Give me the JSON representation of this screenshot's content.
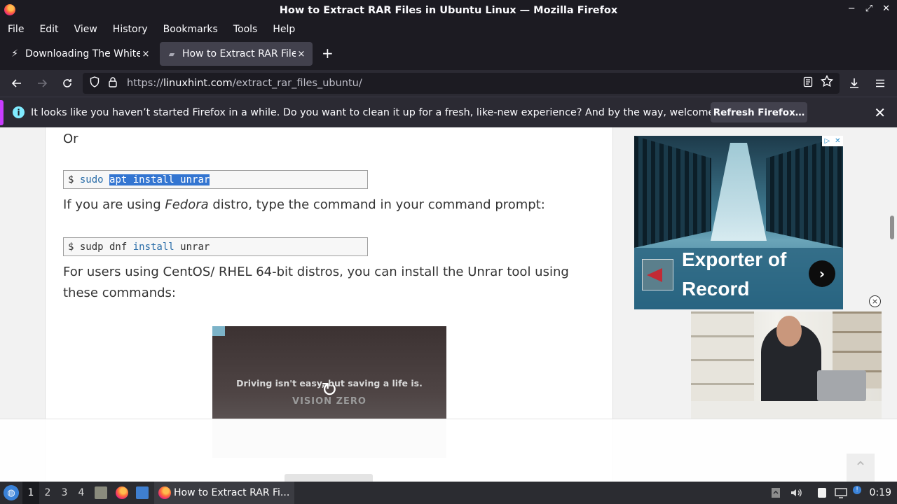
{
  "window": {
    "title": "How to Extract RAR Files in Ubuntu Linux — Mozilla Firefox",
    "controls": {
      "minimize": "−",
      "maximize": "⤢",
      "close": "✕"
    }
  },
  "menu": [
    "File",
    "Edit",
    "View",
    "History",
    "Bookmarks",
    "Tools",
    "Help"
  ],
  "tabs": [
    {
      "title": "Downloading The White Ho",
      "icon": "lightning-icon",
      "close": "×"
    },
    {
      "title": "How to Extract RAR Files i",
      "icon": "linuxhint-icon",
      "close": "×"
    }
  ],
  "new_tab": "+",
  "navbar": {
    "url_prefix": "https://",
    "url_domain": "linuxhint.com",
    "url_path": "/extract_rar_files_ubuntu/"
  },
  "notification": {
    "info_glyph": "i",
    "message": "It looks like you haven’t started Firefox in a while. Do you want to clean it up for a fresh, like-new experience? And by the way, welcome back!",
    "button": "Refresh Firefox…",
    "close": "✕"
  },
  "article": {
    "or_text": "Or",
    "code1": {
      "prompt": "$ ",
      "cmd": "sudo",
      "selected": "apt install unrar"
    },
    "fedora_pre": "If you are using ",
    "fedora_em": "Fedora",
    "fedora_post": " distro, type the command in your command prompt:",
    "code2": {
      "prompt": "$ ",
      "cmd": "sudp dnf ",
      "kw": "install",
      "arg": " unrar"
    },
    "centos_line1": "For users using CentOS/ RHEL 64-bit distros, you can install the Unrar tool using",
    "centos_line2": "these commands:"
  },
  "video_ad": {
    "text": "Driving isn't easy, but saving a life is.",
    "logo": "VISION ZERO",
    "replay_glyph": "↻"
  },
  "side_ad": {
    "headline_line1": "Exporter of",
    "headline_line2": "Record",
    "arrow_glyph": "›",
    "adchoices": "▷",
    "adclose": "✕"
  },
  "ad_close_glyph": "×",
  "scroll_top_glyph": "⌃",
  "taskbar": {
    "workspaces": [
      "1",
      "2",
      "3",
      "4"
    ],
    "current_workspace": "1",
    "task_title": "How to Extract RAR Fi...",
    "clock": "0:19",
    "tray_notification": "!"
  },
  "colors": {
    "selection": "#3375d1",
    "notification_accent": "#c93dff",
    "info_icon": "#80ebff",
    "code_keyword": "#2a6da8"
  }
}
